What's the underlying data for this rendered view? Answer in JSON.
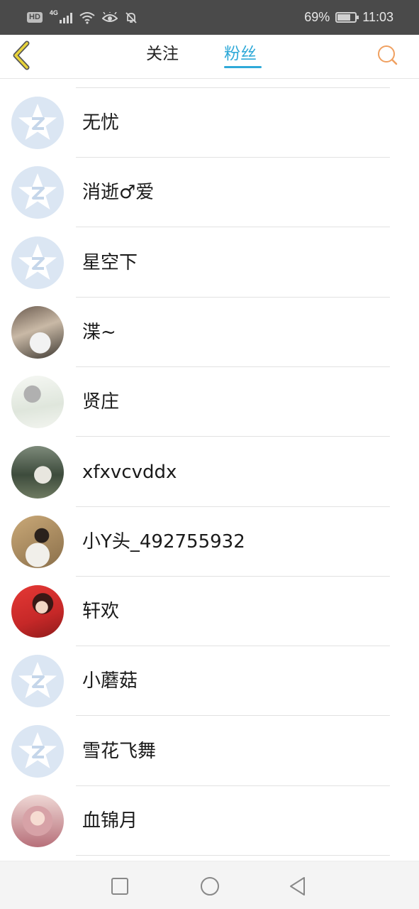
{
  "status_bar": {
    "hd": "HD",
    "network": "4G",
    "battery_percent": "69%",
    "battery_level": 0.69,
    "time": "11:03",
    "icons": [
      "signal-icon",
      "wifi-icon",
      "eye-comfort-icon",
      "mute-icon",
      "battery-charging-icon"
    ]
  },
  "header": {
    "back_icon": "chevron-left-icon",
    "tabs": [
      {
        "label": "关注",
        "active": false
      },
      {
        "label": "粉丝",
        "active": true
      }
    ],
    "search_icon": "search-icon",
    "accent_color": "#2fa9d8",
    "back_color": "#e8d33a",
    "search_color": "#f0a060"
  },
  "fans": [
    {
      "name": "无忧",
      "avatar": "default-qq-avatar"
    },
    {
      "name": "消逝♂爱",
      "avatar": "default-qq-avatar"
    },
    {
      "name": "星空下",
      "avatar": "default-qq-avatar"
    },
    {
      "name": "渫~",
      "avatar": "photo-avatar"
    },
    {
      "name": "贤庄",
      "avatar": "photo-avatar"
    },
    {
      "name": "xfxvcvddx",
      "avatar": "photo-avatar"
    },
    {
      "name": "小Y头_492755932",
      "avatar": "photo-avatar"
    },
    {
      "name": "轩欢",
      "avatar": "photo-avatar"
    },
    {
      "name": "小蘑菇",
      "avatar": "default-qq-avatar"
    },
    {
      "name": "雪花飞舞",
      "avatar": "default-qq-avatar"
    },
    {
      "name": "血锦月",
      "avatar": "photo-avatar"
    }
  ],
  "nav_bar": {
    "icons": [
      "recent-apps-icon",
      "home-icon",
      "back-icon"
    ]
  }
}
